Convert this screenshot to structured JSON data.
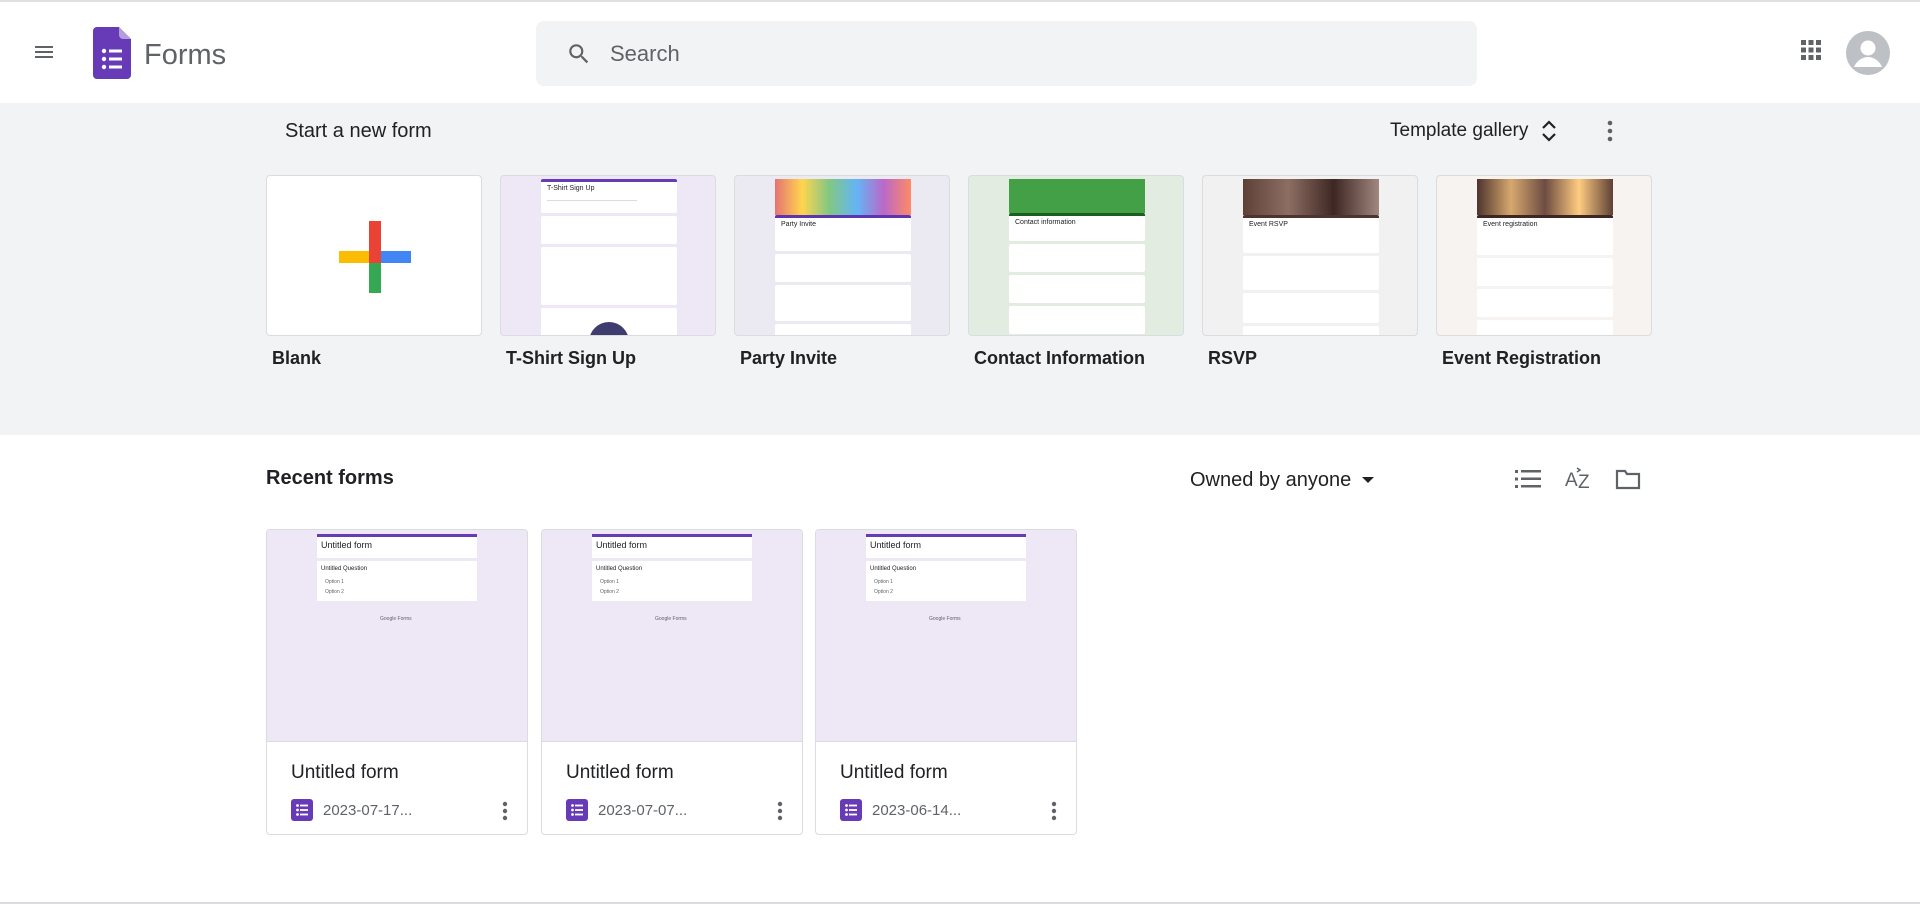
{
  "header": {
    "app_name": "Forms",
    "search_placeholder": "Search"
  },
  "start_section": {
    "title": "Start a new form",
    "gallery_label": "Template gallery"
  },
  "templates": [
    {
      "name": "Blank",
      "preview_title": ""
    },
    {
      "name": "T-Shirt Sign Up",
      "preview_title": "T-Shirt Sign Up"
    },
    {
      "name": "Party Invite",
      "preview_title": "Party Invite"
    },
    {
      "name": "Contact Information",
      "preview_title": "Contact information"
    },
    {
      "name": "RSVP",
      "preview_title": "Event RSVP"
    },
    {
      "name": "Event Registration",
      "preview_title": "Event registration"
    }
  ],
  "recent": {
    "title": "Recent forms",
    "filter_label": "Owned by anyone",
    "forms": [
      {
        "title": "Untitled form",
        "date": "2023-07-17...",
        "preview_title": "Untitled form",
        "preview_question": "Untitled Question",
        "option1": "Option 1",
        "option2": "Option 2",
        "footer": "Google Forms"
      },
      {
        "title": "Untitled form",
        "date": "2023-07-07...",
        "preview_title": "Untitled form",
        "preview_question": "Untitled Question",
        "option1": "Option 1",
        "option2": "Option 2",
        "footer": "Google Forms"
      },
      {
        "title": "Untitled form",
        "date": "2023-06-14...",
        "preview_title": "Untitled form",
        "preview_question": "Untitled Question",
        "option1": "Option 1",
        "option2": "Option 2",
        "footer": "Google Forms"
      }
    ]
  },
  "colors": {
    "forms_purple": "#673ab7",
    "preview_bg": "#ede7f6",
    "section_bg": "#f1f3f4"
  }
}
